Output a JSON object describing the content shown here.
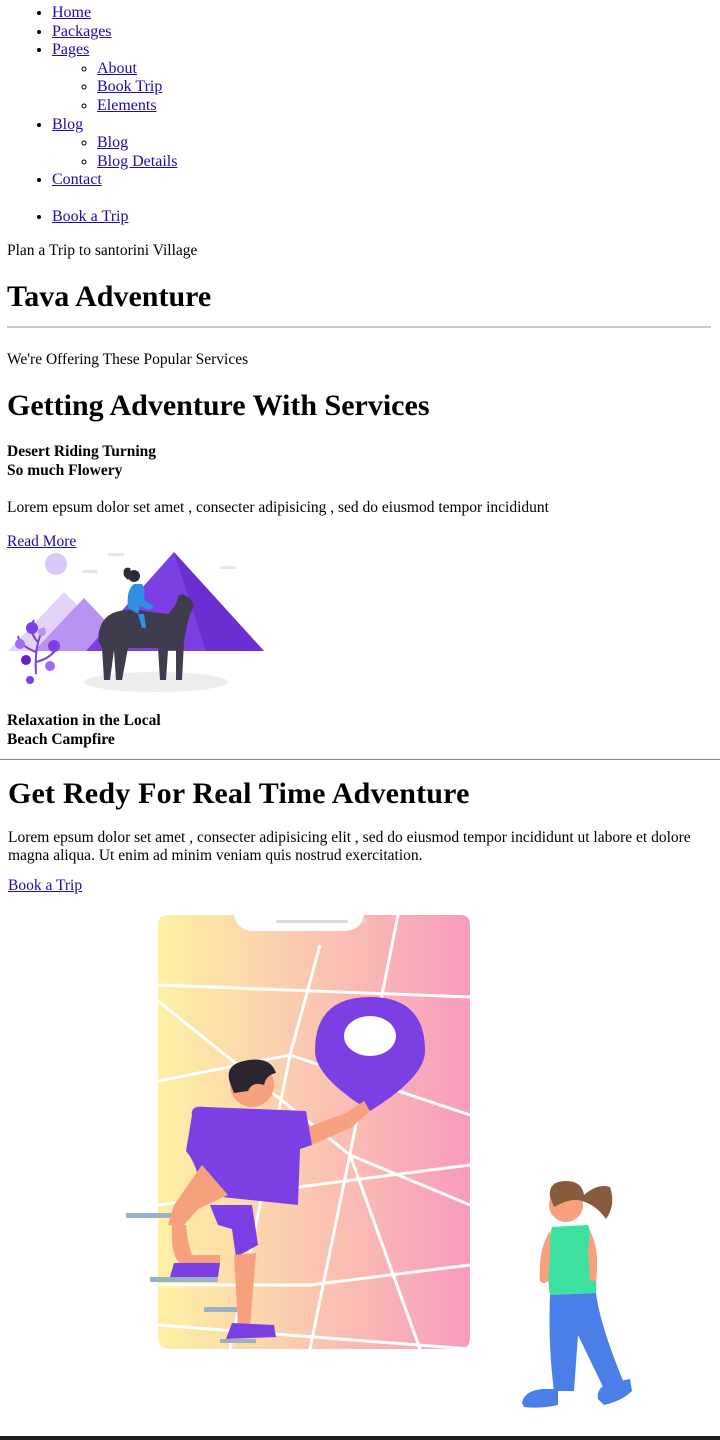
{
  "nav": {
    "home": "Home",
    "packages": "Packages",
    "pages": "Pages",
    "pages_sub": {
      "about": "About",
      "book_trip": "Book Trip",
      "elements": "Elements"
    },
    "blog": "Blog",
    "blog_sub": {
      "blog": "Blog",
      "blog_details": "Blog Details"
    },
    "contact": "Contact",
    "book_a_trip": "Book a Trip"
  },
  "hero": {
    "tagline": "Plan a Trip to santorini Village",
    "title": "Tava Adventure"
  },
  "services": {
    "kicker": "We're Offering These Popular Services",
    "title": "Getting Adventure With Services",
    "item1": {
      "line1": "Desert Riding Turning",
      "line2": "So much Flowery"
    },
    "description": "Lorem epsum dolor set amet , consecter adipisicing , sed do eiusmod tempor incididunt",
    "read_more": "Read More",
    "item2": {
      "line1": "Relaxation in the Local",
      "line2": "Beach Campfire"
    }
  },
  "adventure": {
    "title": "Get Redy For Real Time Adventure",
    "description": "Lorem epsum dolor set amet , consecter adipisicing elit , sed do eiusmod tempor incididunt ut labore et dolore magna aliqua. Ut enim ad minim veniam quis nostrud exercitation.",
    "book_button": "Book a Trip"
  },
  "colors": {
    "link": "#1a0dab",
    "purple": "#7b3fe4",
    "gradient_start": "#fdf1a4",
    "gradient_end": "#f79bbd"
  },
  "icons": [
    "desert-camel-illustration",
    "map-phone-illustration",
    "location-pin-icon"
  ]
}
